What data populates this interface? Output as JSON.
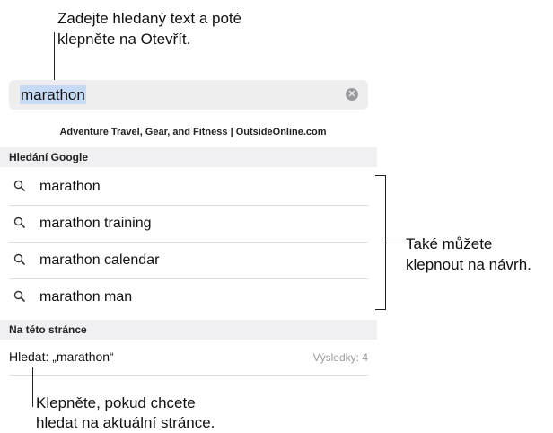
{
  "callouts": {
    "top_line1": "Zadejte hledaný text a poté",
    "top_line2": "klepněte na Otevřít.",
    "right_line1": "Také můžete",
    "right_line2": "klepnout na návrh.",
    "bottom_line1": "Klepněte, pokud chcete",
    "bottom_line2": "hledat na aktuální stránce."
  },
  "search": {
    "value": "marathon",
    "clear_icon": "clear-icon"
  },
  "top_hit": "Adventure Travel, Gear, and Fitness | OutsideOnline.com",
  "google_section": {
    "header": "Hledání Google",
    "suggestions": [
      "marathon",
      "marathon training",
      "marathon calendar",
      "marathon man"
    ]
  },
  "page_section": {
    "header": "Na této stránce",
    "find_label": "Hledat: „marathon“",
    "find_count": "Výsledky: 4"
  },
  "colors": {
    "selection": "#c7daf5",
    "field": "#eeeeef",
    "header_bg": "#f0f0f2",
    "muted": "#9a9a9e"
  }
}
